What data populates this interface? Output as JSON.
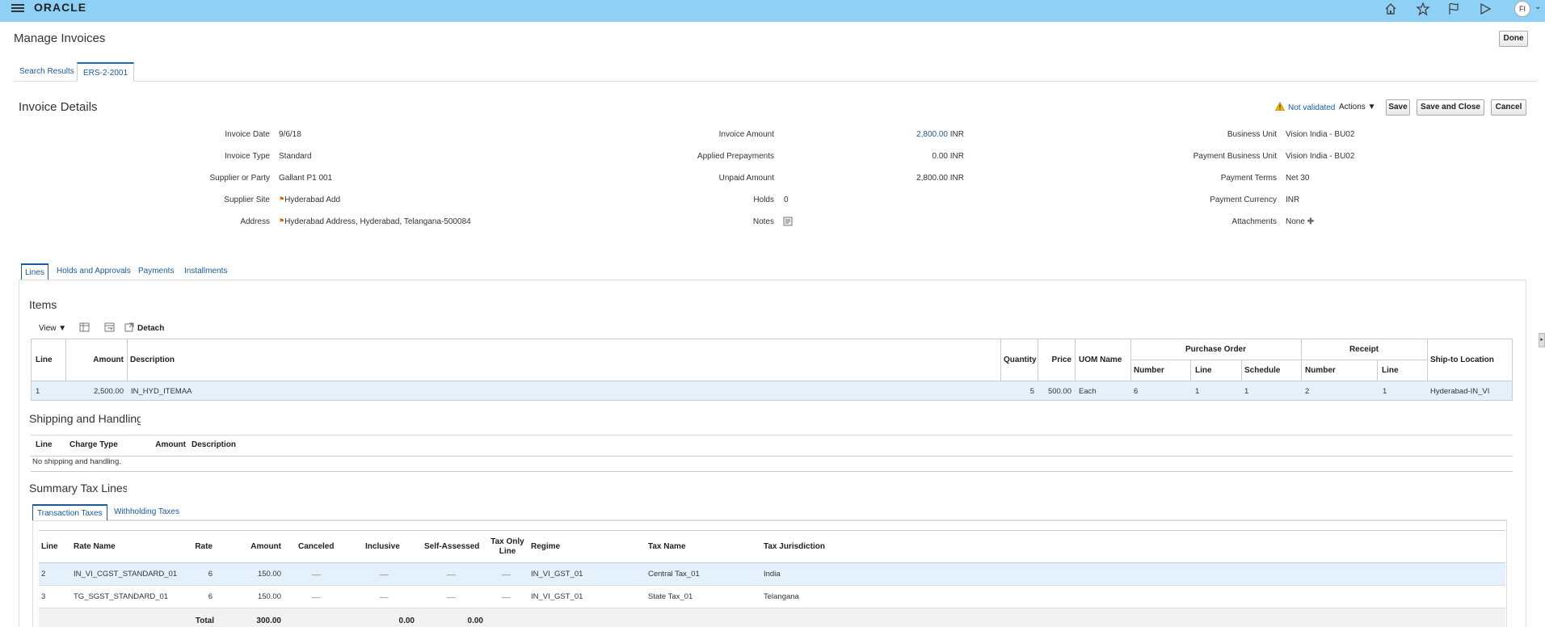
{
  "header": {
    "logo": "ORACLE",
    "avatar_initials": "FI",
    "icons": [
      "home-icon",
      "favorites-icon",
      "watchlist-icon",
      "notifications-icon"
    ]
  },
  "page": {
    "title": "Manage Invoices",
    "done_label": "Done"
  },
  "tabs": [
    {
      "label": "Search Results",
      "active": false
    },
    {
      "label": "ERS-2-2001",
      "active": true
    }
  ],
  "invoice": {
    "section_title": "Invoice Details",
    "validation_status": "Not validated",
    "actions_label": "Actions",
    "save_label": "Save",
    "save_close_label": "Save and Close",
    "cancel_label": "Cancel",
    "col1": [
      {
        "label": "Invoice Date",
        "value": "9/6/18"
      },
      {
        "label": "Invoice Type",
        "value": "Standard"
      },
      {
        "label": "Supplier or Party",
        "value": "Gallant P1 001"
      },
      {
        "label": "Supplier Site",
        "value": "Hyderabad Add"
      },
      {
        "label": "Address",
        "value": "Hyderabad Address, Hyderabad, Telangana-500084"
      }
    ],
    "col2": [
      {
        "label": "Invoice Amount",
        "value": "2,800.00",
        "unit": "INR"
      },
      {
        "label": "Applied Prepayments",
        "value": "0.00 INR"
      },
      {
        "label": "Unpaid Amount",
        "value": "2,800.00 INR"
      },
      {
        "label": "Holds",
        "value": "0"
      },
      {
        "label": "Notes",
        "value": ""
      }
    ],
    "col3": [
      {
        "label": "Business Unit",
        "value": "Vision India - BU02"
      },
      {
        "label": "Payment Business Unit",
        "value": "Vision India - BU02"
      },
      {
        "label": "Payment Terms",
        "value": "Net 30"
      },
      {
        "label": "Payment Currency",
        "value": "INR"
      },
      {
        "label": "Attachments",
        "value": "None"
      }
    ]
  },
  "detail_tabs": [
    {
      "label": "Lines",
      "active": true
    },
    {
      "label": "Holds and Approvals",
      "active": false
    },
    {
      "label": "Payments",
      "active": false
    },
    {
      "label": "Installments",
      "active": false
    }
  ],
  "items": {
    "title": "Items",
    "view_label": "View",
    "detach_label": "Detach",
    "headers": {
      "line": "Line",
      "amount": "Amount",
      "description": "Description",
      "quantity": "Quantity",
      "price": "Price",
      "uom": "UOM Name",
      "po_group": "Purchase Order",
      "po_number": "Number",
      "po_line": "Line",
      "po_schedule": "Schedule",
      "receipt_group": "Receipt",
      "receipt_number": "Number",
      "receipt_line": "Line",
      "ship_to": "Ship-to Location"
    },
    "rows": [
      {
        "line": "1",
        "amount": "2,500.00",
        "description": "IN_HYD_ITEMAA",
        "quantity": "5",
        "price": "500.00",
        "uom": "Each",
        "po_number": "6",
        "po_line": "1",
        "po_schedule": "1",
        "receipt_number": "2",
        "receipt_line": "1",
        "ship_to": "Hyderabad-IN_VI"
      }
    ]
  },
  "shipping": {
    "title": "Shipping and Handling",
    "headers": {
      "line": "Line",
      "charge_type": "Charge Type",
      "amount": "Amount",
      "description": "Description"
    },
    "empty_text": "No shipping and handling."
  },
  "tax": {
    "title": "Summary Tax Lines",
    "tabs": [
      {
        "label": "Transaction Taxes",
        "active": true
      },
      {
        "label": "Withholding Taxes",
        "active": false
      }
    ],
    "headers": {
      "line": "Line",
      "rate_name": "Rate Name",
      "rate": "Rate",
      "amount": "Amount",
      "canceled": "Canceled",
      "inclusive": "Inclusive",
      "self_assessed": "Self-Assessed",
      "tax_only_line_1": "Tax Only",
      "tax_only_line_2": "Line",
      "regime": "Regime",
      "tax_name": "Tax Name",
      "tax_jurisdiction": "Tax Jurisdiction"
    },
    "rows": [
      {
        "line": "2",
        "rate_name": "IN_VI_CGST_STANDARD_01",
        "rate": "6",
        "amount": "150.00",
        "canceled": "__",
        "inclusive": "__",
        "self_assessed": "__",
        "tax_only": "__",
        "regime": "IN_VI_GST_01",
        "tax_name": "Central Tax_01",
        "jurisdiction": "India"
      },
      {
        "line": "3",
        "rate_name": "TG_SGST_STANDARD_01",
        "rate": "6",
        "amount": "150.00",
        "canceled": "__",
        "inclusive": "__",
        "self_assessed": "__",
        "tax_only": "__",
        "regime": "IN_VI_GST_01",
        "tax_name": "State Tax_01",
        "jurisdiction": "Telangana"
      }
    ],
    "total_label": "Total",
    "total_amount": "300.00",
    "total_inclusive": "0.00",
    "total_self_assessed": "0.00"
  }
}
